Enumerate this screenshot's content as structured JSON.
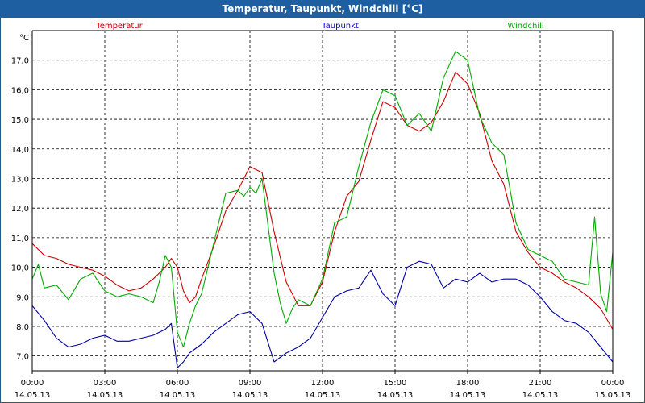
{
  "window": {
    "title": "Temperatur, Taupunkt, Windchill [°C]"
  },
  "chart_data": {
    "type": "line",
    "unit_label": "°C",
    "ylim": [
      6.5,
      18.0
    ],
    "xlim": [
      0,
      24
    ],
    "grid": true,
    "y_ticks": [
      "7,0",
      "8,0",
      "9,0",
      "10,0",
      "11,0",
      "12,0",
      "13,0",
      "14,0",
      "15,0",
      "16,0",
      "17,0"
    ],
    "y_tick_values": [
      7,
      8,
      9,
      10,
      11,
      12,
      13,
      14,
      15,
      16,
      17
    ],
    "x_ticks": [
      {
        "time": "00:00",
        "date": "14.05.13"
      },
      {
        "time": "03:00",
        "date": "14.05.13"
      },
      {
        "time": "06:00",
        "date": "14.05.13"
      },
      {
        "time": "09:00",
        "date": "14.05.13"
      },
      {
        "time": "12:00",
        "date": "14.05.13"
      },
      {
        "time": "15:00",
        "date": "14.05.13"
      },
      {
        "time": "18:00",
        "date": "14.05.13"
      },
      {
        "time": "21:00",
        "date": "14.05.13"
      },
      {
        "time": "00:00",
        "date": "15.05.13"
      }
    ],
    "x_tick_hours": [
      0,
      3,
      6,
      9,
      12,
      15,
      18,
      21,
      24
    ],
    "series": [
      {
        "name": "Temperatur",
        "color": "#cc0000",
        "x": [
          0,
          0.5,
          1,
          1.5,
          2,
          2.5,
          3,
          3.5,
          4,
          4.5,
          5,
          5.5,
          5.75,
          6,
          6.25,
          6.5,
          6.75,
          7,
          7.5,
          8,
          8.5,
          9,
          9.5,
          10,
          10.5,
          11,
          11.5,
          12,
          12.5,
          13,
          13.5,
          14,
          14.5,
          15,
          15.5,
          16,
          16.5,
          17,
          17.5,
          18,
          18.5,
          19,
          19.5,
          20,
          20.5,
          21,
          21.5,
          22,
          22.5,
          23,
          23.5,
          24
        ],
        "y": [
          10.8,
          10.4,
          10.3,
          10.1,
          10.0,
          9.9,
          9.7,
          9.4,
          9.2,
          9.3,
          9.6,
          10.0,
          10.3,
          10.0,
          9.2,
          8.8,
          9.0,
          9.6,
          10.7,
          11.9,
          12.6,
          13.4,
          13.2,
          11.2,
          9.5,
          8.7,
          8.7,
          9.5,
          11.2,
          12.4,
          12.9,
          14.3,
          15.6,
          15.4,
          14.8,
          14.6,
          14.9,
          15.6,
          16.6,
          16.2,
          15.2,
          13.6,
          12.8,
          11.2,
          10.5,
          10.0,
          9.8,
          9.5,
          9.3,
          9.0,
          8.6,
          7.9
        ]
      },
      {
        "name": "Taupunkt",
        "color": "#0000aa",
        "x": [
          0,
          0.5,
          1,
          1.5,
          2,
          2.5,
          3,
          3.5,
          4,
          4.5,
          5,
          5.5,
          5.75,
          6,
          6.25,
          6.5,
          7,
          7.5,
          8,
          8.5,
          9,
          9.5,
          10,
          10.5,
          11,
          11.5,
          12,
          12.5,
          13,
          13.5,
          14,
          14.5,
          15,
          15.5,
          16,
          16.5,
          17,
          17.5,
          18,
          18.5,
          19,
          19.5,
          20,
          20.5,
          21,
          21.5,
          22,
          22.5,
          23,
          23.5,
          24
        ],
        "y": [
          8.7,
          8.2,
          7.6,
          7.3,
          7.4,
          7.6,
          7.7,
          7.5,
          7.5,
          7.6,
          7.7,
          7.9,
          8.1,
          6.6,
          6.8,
          7.1,
          7.4,
          7.8,
          8.1,
          8.4,
          8.5,
          8.1,
          6.8,
          7.1,
          7.3,
          7.6,
          8.3,
          9.0,
          9.2,
          9.3,
          9.9,
          9.1,
          8.7,
          10.0,
          10.2,
          10.1,
          9.3,
          9.6,
          9.5,
          9.8,
          9.5,
          9.6,
          9.6,
          9.4,
          9.0,
          8.5,
          8.2,
          8.1,
          7.8,
          7.3,
          6.8
        ]
      },
      {
        "name": "Windchill",
        "color": "#00aa00",
        "x": [
          0,
          0.25,
          0.5,
          1,
          1.5,
          2,
          2.5,
          3,
          3.5,
          4,
          4.5,
          5,
          5.25,
          5.5,
          5.75,
          6,
          6.25,
          6.5,
          6.75,
          7,
          7.5,
          8,
          8.5,
          8.75,
          9,
          9.25,
          9.5,
          9.75,
          10,
          10.25,
          10.5,
          10.75,
          11,
          11.5,
          12,
          12.5,
          13,
          13.5,
          14,
          14.5,
          15,
          15.5,
          16,
          16.5,
          17,
          17.5,
          18,
          18.5,
          19,
          19.5,
          20,
          20.5,
          21,
          21.5,
          22,
          22.5,
          23,
          23.25,
          23.5,
          23.75,
          24
        ],
        "y": [
          9.6,
          10.1,
          9.3,
          9.4,
          8.9,
          9.6,
          9.8,
          9.2,
          9.0,
          9.1,
          9.0,
          8.8,
          9.5,
          10.4,
          10.0,
          7.8,
          7.3,
          8.1,
          8.7,
          9.1,
          10.8,
          12.5,
          12.6,
          12.4,
          12.7,
          12.5,
          13.0,
          11.4,
          9.8,
          8.8,
          8.1,
          8.6,
          8.9,
          8.7,
          9.6,
          11.5,
          11.7,
          13.4,
          14.9,
          16.0,
          15.8,
          14.8,
          15.2,
          14.6,
          16.4,
          17.3,
          17.0,
          15.1,
          14.2,
          13.8,
          11.5,
          10.6,
          10.4,
          10.2,
          9.6,
          9.5,
          9.4,
          11.7,
          9.1,
          8.5,
          10.5
        ]
      }
    ]
  }
}
